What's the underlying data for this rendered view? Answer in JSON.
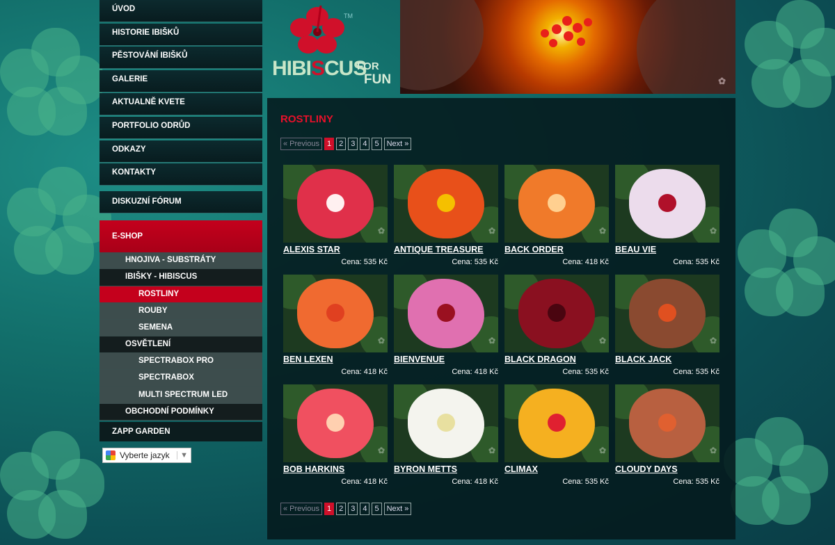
{
  "logo": {
    "tm": "TM",
    "brand_a": "HIBI",
    "brand_b": "S",
    "brand_c": "CUS",
    "for": "FOR",
    "fun": "FUN"
  },
  "nav": {
    "items": [
      "ÚVOD",
      "HISTORIE IBIŠKŮ",
      "PĚSTOVÁNÍ IBIŠKŮ",
      "GALERIE",
      "AKTUALNĚ KVETE",
      "PORTFOLIO ODRŮD",
      "ODKAZY",
      "KONTAKTY"
    ],
    "forum": "DISKUZNÍ FÓRUM",
    "eshop": "E-SHOP",
    "eshop_sub": [
      {
        "label": "HNOJIVA - SUBSTRÁTY"
      },
      {
        "label": "IBIŠKY - HIBISCUS"
      },
      {
        "label": "ROSTLINY"
      },
      {
        "label": "ROUBY"
      },
      {
        "label": "SEMENA"
      },
      {
        "label": "OSVĚTLENÍ"
      },
      {
        "label": "SPECTRABOX PRO"
      },
      {
        "label": "SPECTRABOX"
      },
      {
        "label": "MULTI SPECTRUM LED"
      },
      {
        "label": "OBCHODNÍ PODMÍNKY"
      }
    ],
    "zapp": "ZAPP GARDEN"
  },
  "translate": {
    "label": "Vyberte jazyk",
    "arrow": "▼"
  },
  "page": {
    "title": "ROSTLINY"
  },
  "pager": {
    "prev": "« Previous",
    "pages": [
      "1",
      "2",
      "3",
      "4",
      "5"
    ],
    "current": "1",
    "next": "Next »"
  },
  "products": [
    {
      "name": "ALEXIS STAR",
      "price": "Cena: 535 Kč",
      "color": "#e0304a",
      "eye": "#fff0f0"
    },
    {
      "name": "ANTIQUE TREASURE",
      "price": "Cena: 535 Kč",
      "color": "#e8501a",
      "eye": "#f5c000"
    },
    {
      "name": "BACK ORDER",
      "price": "Cena: 418 Kč",
      "color": "#f07a2a",
      "eye": "#ffd090"
    },
    {
      "name": "BEAU VIE",
      "price": "Cena: 535 Kč",
      "color": "#ecdcec",
      "eye": "#b0102a"
    },
    {
      "name": "BEN LEXEN",
      "price": "Cena: 418 Kč",
      "color": "#f06a30",
      "eye": "#e04020"
    },
    {
      "name": "BIENVENUE",
      "price": "Cena: 418 Kč",
      "color": "#e070b0",
      "eye": "#9a1020"
    },
    {
      "name": "BLACK DRAGON",
      "price": "Cena: 535 Kč",
      "color": "#8a1020",
      "eye": "#4a0510"
    },
    {
      "name": "BLACK JACK",
      "price": "Cena: 535 Kč",
      "color": "#8a4a30",
      "eye": "#e05020"
    },
    {
      "name": "BOB HARKINS",
      "price": "Cena: 418 Kč",
      "color": "#f05060",
      "eye": "#ffd0b0"
    },
    {
      "name": "BYRON METTS",
      "price": "Cena: 418 Kč",
      "color": "#f4f4ee",
      "eye": "#e8e0a0"
    },
    {
      "name": "CLIMAX",
      "price": "Cena: 535 Kč",
      "color": "#f5b020",
      "eye": "#e02030"
    },
    {
      "name": "CLOUDY DAYS",
      "price": "Cena: 535 Kč",
      "color": "#b86040",
      "eye": "#e06030"
    }
  ],
  "colors": {
    "accent": "#d0102a",
    "panel": "#05191c",
    "sidebar": "#0c2a2e"
  }
}
